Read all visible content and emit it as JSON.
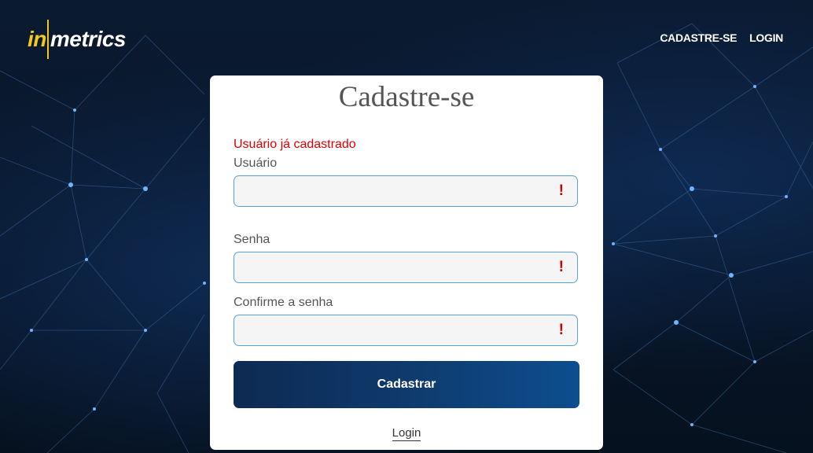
{
  "header": {
    "logo": {
      "part1": "in",
      "part2": "metrics"
    },
    "nav": [
      {
        "label": "CADASTRE-SE"
      },
      {
        "label": "LOGIN"
      }
    ]
  },
  "form": {
    "title": "Cadastre-se",
    "error_message": "Usuário já cadastrado",
    "fields": [
      {
        "label": "Usuário",
        "value": "",
        "placeholder": "",
        "warning_icon": "!"
      },
      {
        "label": "Senha",
        "value": "",
        "placeholder": "",
        "warning_icon": "!"
      },
      {
        "label": "Confirme a senha",
        "value": "",
        "placeholder": "",
        "warning_icon": "!"
      }
    ],
    "submit_label": "Cadastrar",
    "login_link": "Login"
  },
  "colors": {
    "accent": "#f2c81a",
    "error": "#e00000",
    "button_dark": "#0d2a52",
    "field_border": "#5aa0d8"
  }
}
